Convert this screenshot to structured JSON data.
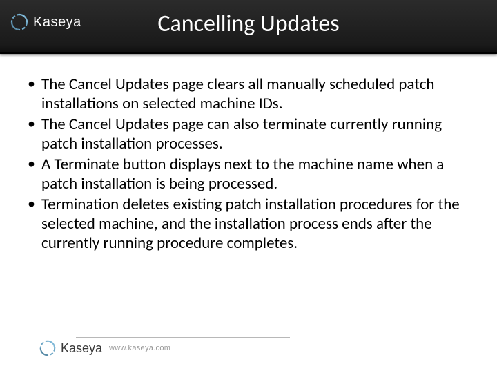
{
  "brand": {
    "name": "Kaseya",
    "url": "www.kaseya.com"
  },
  "title": "Cancelling Updates",
  "bullets": [
    "The Cancel Updates page clears all manually scheduled patch installations on selected machine IDs.",
    "The Cancel Updates page can also terminate currently running patch installation processes.",
    "A Terminate button displays next to the machine name when a patch installation is being processed.",
    "Termination deletes existing patch installation procedures for the selected machine, and the installation process ends after the currently running procedure completes."
  ]
}
